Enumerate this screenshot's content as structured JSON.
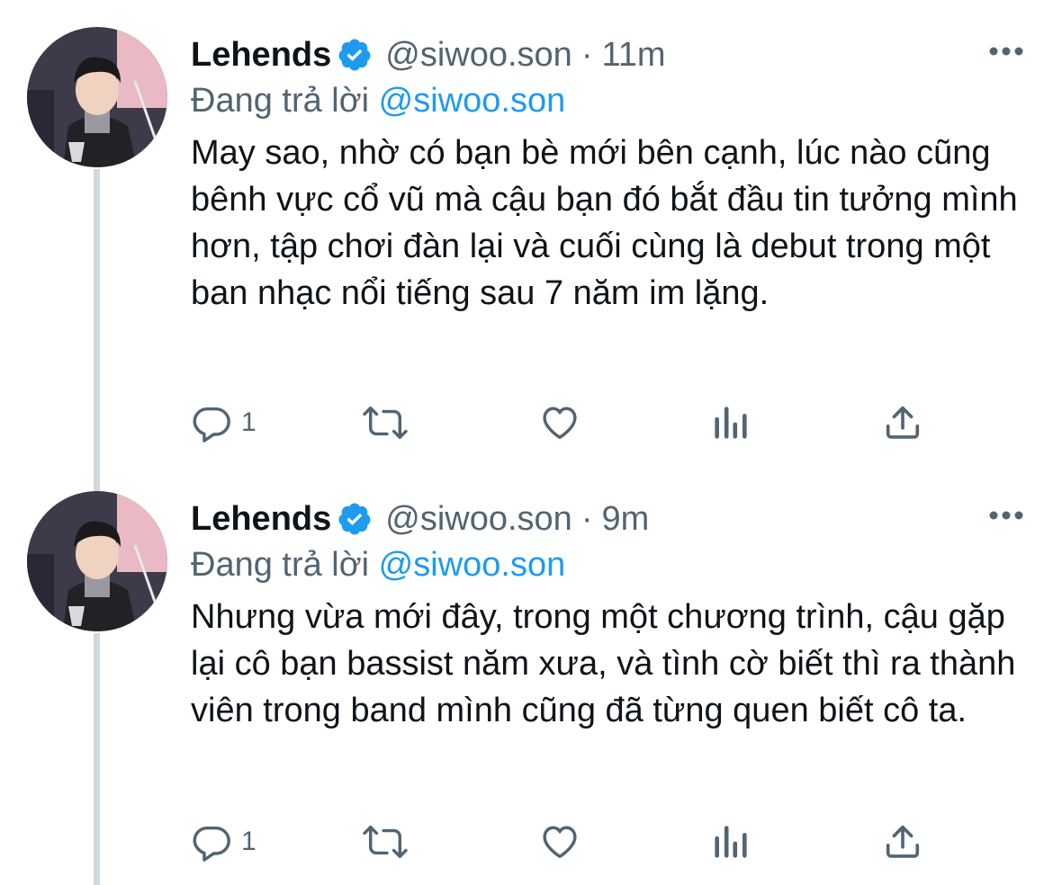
{
  "tweets": [
    {
      "author_name": "Lehends",
      "handle": "@siwoo.son",
      "separator": "·",
      "time": "11m",
      "reply_prefix": "Đang trả lời",
      "reply_to": "@siwoo.son",
      "text": "May sao, nhờ có bạn bè mới bên cạnh, lúc nào cũng bênh vực cổ vũ mà cậu bạn đó bắt đầu tin tưởng mình hơn, tập chơi đàn lại và cuối cùng là debut trong một ban nhạc nổi tiếng sau 7 năm im lặng.",
      "reply_count": "1"
    },
    {
      "author_name": "Lehends",
      "handle": "@siwoo.son",
      "separator": "·",
      "time": "9m",
      "reply_prefix": "Đang trả lời",
      "reply_to": "@siwoo.son",
      "text": "Nhưng vừa mới đây, trong một chương trình, cậu gặp lại cô bạn bassist năm xưa, và tình cờ biết thì ra thành viên trong band mình cũng đã từng quen biết cô ta.",
      "reply_count": "1"
    }
  ],
  "icons": {
    "verified": "verified-badge-icon",
    "more": "more-options-icon",
    "reply": "reply-icon",
    "retweet": "retweet-icon",
    "like": "like-heart-icon",
    "analytics": "analytics-icon",
    "share": "share-icon"
  },
  "colors": {
    "accent": "#1d9bf0",
    "secondary_text": "#536471",
    "thread_line": "#cfd9de"
  }
}
